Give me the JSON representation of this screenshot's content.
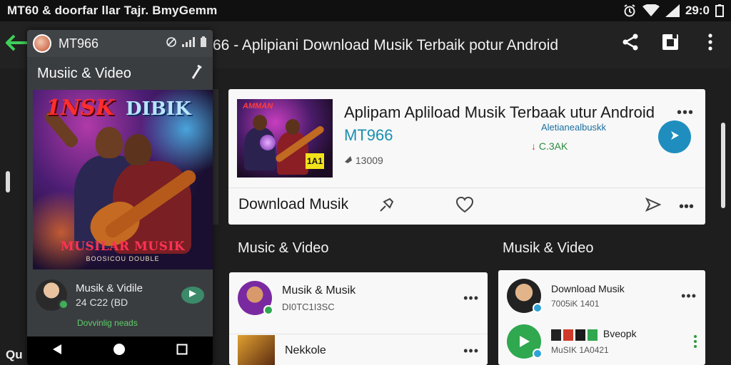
{
  "status_bar": {
    "title": "MT60 & doorfar  llar Tajr. BmyGemm",
    "time": "29:0"
  },
  "app_bar": {
    "title": "66 - Aplipiani Download Musik Terbaik potur Android"
  },
  "phone": {
    "app_name": "MT966",
    "header_title": "Musiic & Video",
    "poster": {
      "title_left": "1NSK",
      "title_right": "DIBIK",
      "title_bottom": "MUSILAR MUSIK",
      "subtitle": "BOOSICOU DOUBLE"
    },
    "card": {
      "title": "Musik & Vidile",
      "subtitle": "24 C22 (BD",
      "download_label": "Dovvinlig neads"
    }
  },
  "featured": {
    "thumb_text": "AMMAN",
    "thumb_badge": "1A1",
    "title": "Aplipam Apliload Musik Terbaak utur Android",
    "subtitle": "MT966",
    "small_label": "Aletianealbuskk",
    "plays": "13009",
    "stat": "C.3AK",
    "download_label": "Download Musik"
  },
  "sections": {
    "left_heading": "Music & Video",
    "right_heading": "Musik & Video"
  },
  "left_list": [
    {
      "title": "Musik & Musik",
      "subtitle": "DI0TC1I3SC"
    },
    {
      "title": "Nekkole",
      "subtitle": ""
    }
  ],
  "right_list": [
    {
      "title": "Download Musik",
      "subtitle": "7005iK 1401"
    },
    {
      "title": "Bveopk",
      "subtitle": "MuSIK 1A0421"
    }
  ],
  "corner_text": "Qu",
  "colors": {
    "accent_blue": "#1f8ebf",
    "accent_teal": "#1a8fb0",
    "accent_green": "#2fa84f",
    "background": "#1e1e1e",
    "card": "#f8f8f8"
  },
  "icons": {
    "back": "back-arrow-icon",
    "share": "share-icon",
    "save": "save-icon",
    "menu": "vertical-dots-icon",
    "alarm": "alarm-icon",
    "wifi": "wifi-icon",
    "signal": "signal-icon",
    "battery": "battery-icon",
    "go": "play-arrow-icon",
    "pin": "pin-icon",
    "heart": "heart-icon",
    "send": "send-icon"
  }
}
